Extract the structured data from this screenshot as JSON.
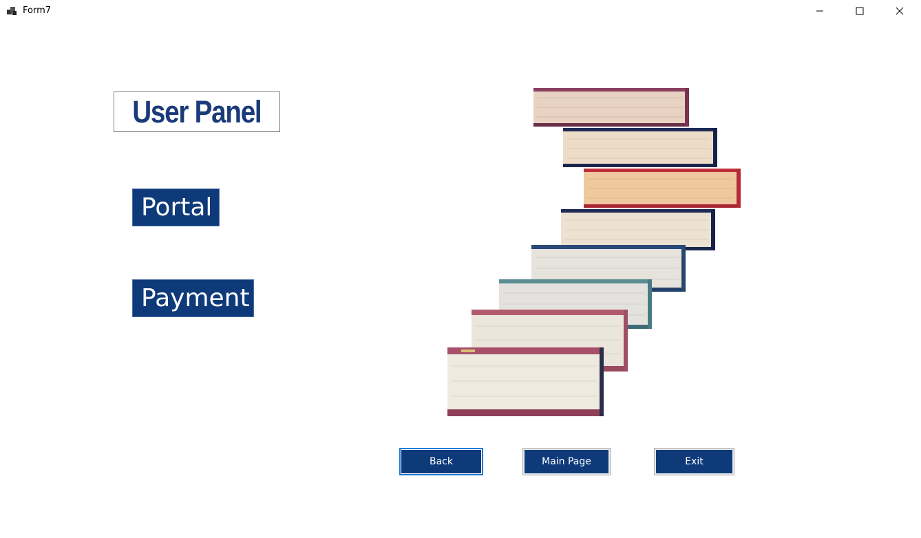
{
  "window": {
    "title": "Form7",
    "icon": "app-icon",
    "controls": {
      "minimize": "minimize-icon",
      "maximize": "maximize-icon",
      "close": "close-icon"
    }
  },
  "main": {
    "panel_title": "User Panel",
    "menu": {
      "portal_label": "Portal",
      "payment_label": "Payment"
    },
    "illustration": "stack-of-books-image"
  },
  "footer": {
    "back_label": "Back",
    "main_page_label": "Main Page",
    "exit_label": "Exit"
  },
  "colors": {
    "button_bg": "#0e3a7a",
    "title_text": "#1a3a7a",
    "focus_border": "#1e7ad6"
  }
}
